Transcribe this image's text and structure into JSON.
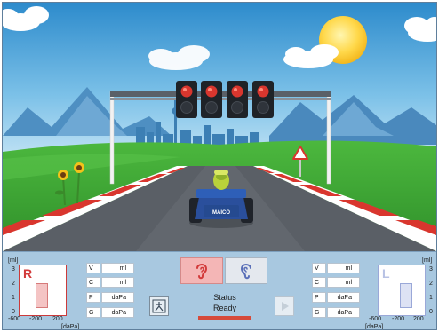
{
  "kart_badge": "MAICO",
  "status": {
    "label": "Status",
    "value": "Ready"
  },
  "right_ear": {
    "letter": "R",
    "y_unit": "[ml]",
    "x_unit": "[daPa]",
    "y_ticks": [
      "3",
      "2",
      "1",
      "0"
    ],
    "x_ticks": [
      "-600",
      "-200",
      "200"
    ],
    "color": "#d23a3a"
  },
  "left_ear": {
    "letter": "L",
    "y_unit": "[ml]",
    "x_unit": "[daPa]",
    "y_ticks": [
      "3",
      "2",
      "1",
      "0"
    ],
    "x_ticks": [
      "-600",
      "-200",
      "200"
    ],
    "color": "#7f8fd0"
  },
  "right_fields": [
    {
      "key": "V",
      "unit": "ml"
    },
    {
      "key": "C",
      "unit": "ml"
    },
    {
      "key": "P",
      "unit": "daPa"
    },
    {
      "key": "G",
      "unit": "daPa"
    }
  ],
  "left_fields": [
    {
      "key": "V",
      "unit": "ml"
    },
    {
      "key": "C",
      "unit": "ml"
    },
    {
      "key": "P",
      "unit": "daPa"
    },
    {
      "key": "G",
      "unit": "daPa"
    }
  ],
  "icons": {
    "right_ear": "ear-icon",
    "left_ear": "ear-icon",
    "person": "person-icon",
    "play": "play-icon"
  },
  "colors": {
    "status_bar": "#d64a3a",
    "right_ear_tab": "#f4b6b6",
    "left_ear_tab": "#e4e8ee",
    "sky_top": "#2f8fcf",
    "grass": "#3fa83a"
  }
}
